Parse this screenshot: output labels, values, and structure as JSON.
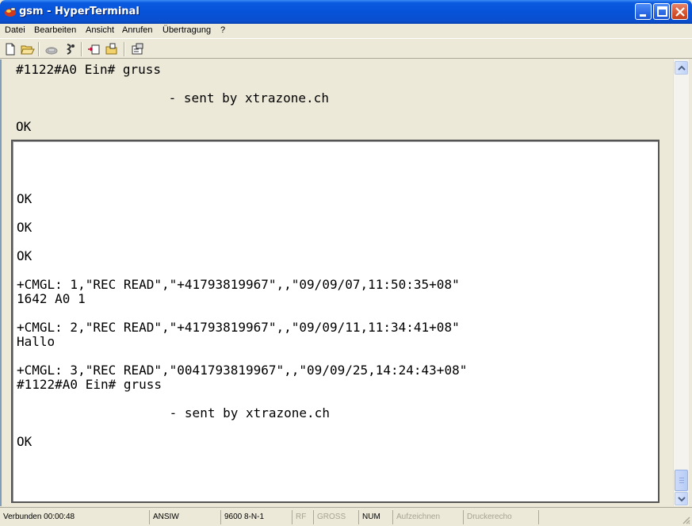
{
  "window": {
    "title": "gsm - HyperTerminal",
    "accent": "#0653d8"
  },
  "menu": {
    "items": [
      "Datei",
      "Bearbeiten",
      "Ansicht",
      "Anrufen",
      "Übertragung",
      "?"
    ]
  },
  "toolbar": {
    "icons": [
      "new-document-icon",
      "open-folder-icon",
      "connect-phone-icon",
      "disconnect-icon",
      "send-file-icon",
      "receive-file-icon",
      "properties-icon"
    ]
  },
  "terminal_background": {
    "lines": [
      "#1122#A0 Ein# gruss",
      "                    - sent by xtrazone.ch",
      "OK"
    ]
  },
  "terminal_overlay": {
    "lines": [
      "OK",
      "OK",
      "OK",
      "+CMGL: 1,\"REC READ\",\"+41793819967\",,\"09/09/07,11:50:35+08\"",
      "1642 A0 1",
      "+CMGL: 2,\"REC READ\",\"+41793819967\",,\"09/09/11,11:34:41+08\"",
      "Hallo",
      "+CMGL: 3,\"REC READ\",\"0041793819967\",,\"09/09/25,14:24:43+08\"",
      "#1122#A0 Ein# gruss",
      "                    - sent by xtrazone.ch",
      "OK"
    ]
  },
  "status": {
    "connection": "Verbunden 00:00:48",
    "emulation": "ANSIW",
    "port_settings": "9600 8-N-1",
    "rf": "RF",
    "caps": "GROSS",
    "num": "NUM",
    "capture": "Aufzeichnen",
    "print_echo": "Druckerecho"
  }
}
